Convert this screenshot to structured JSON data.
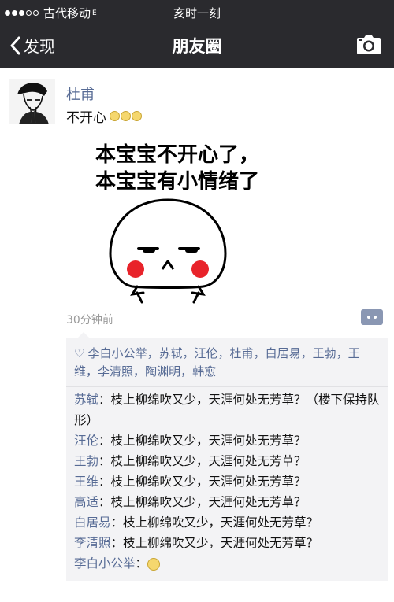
{
  "status_bar": {
    "carrier": "古代移动",
    "network": "E",
    "time": "亥时一刻"
  },
  "nav": {
    "back_label": "发现",
    "title": "朋友圈"
  },
  "post": {
    "author": "杜甫",
    "text": "不开心",
    "meme_line1": "本宝宝不开心了，",
    "meme_line2": "本宝宝有小情绪了",
    "time": "30分钟前"
  },
  "likes": [
    "李白小公举",
    "苏轼",
    "汪伦",
    "杜甫",
    "白居易",
    "王勃",
    "王维",
    "李清照",
    "陶渊明",
    "韩愈"
  ],
  "likes_separator": "，",
  "comments": [
    {
      "author": "苏轼",
      "colon": "：",
      "text": "枝上柳绵吹又少，天涯何处无芳草？（楼下保持队形）"
    },
    {
      "author": "汪伦",
      "colon": "：",
      "text": "枝上柳绵吹又少，天涯何处无芳草？"
    },
    {
      "author": "王勃",
      "colon": "：",
      "text": "枝上柳绵吹又少，天涯何处无芳草？"
    },
    {
      "author": "王维",
      "colon": "：",
      "text": "枝上柳绵吹又少，天涯何处无芳草？"
    },
    {
      "author": "高适",
      "colon": "：",
      "text": "枝上柳绵吹又少，天涯何处无芳草？"
    },
    {
      "author": "白居易",
      "colon": "：",
      "text": "枝上柳绵吹又少，天涯何处无芳草？"
    },
    {
      "author": "李清照",
      "colon": "：",
      "text": "枝上柳绵吹又少，天涯何处无芳草？"
    },
    {
      "author": "李白小公举",
      "colon": "：",
      "text": ""
    }
  ],
  "colors": {
    "bar_bg": "#2a2a2e",
    "link_blue": "#576b95",
    "blush_red": "#e8232a",
    "box_bg": "#f3f3f5"
  },
  "icons": {
    "back": "chevron-left-icon",
    "camera": "camera-icon",
    "like": "heart-icon",
    "comment": "comment-menu-icon"
  }
}
